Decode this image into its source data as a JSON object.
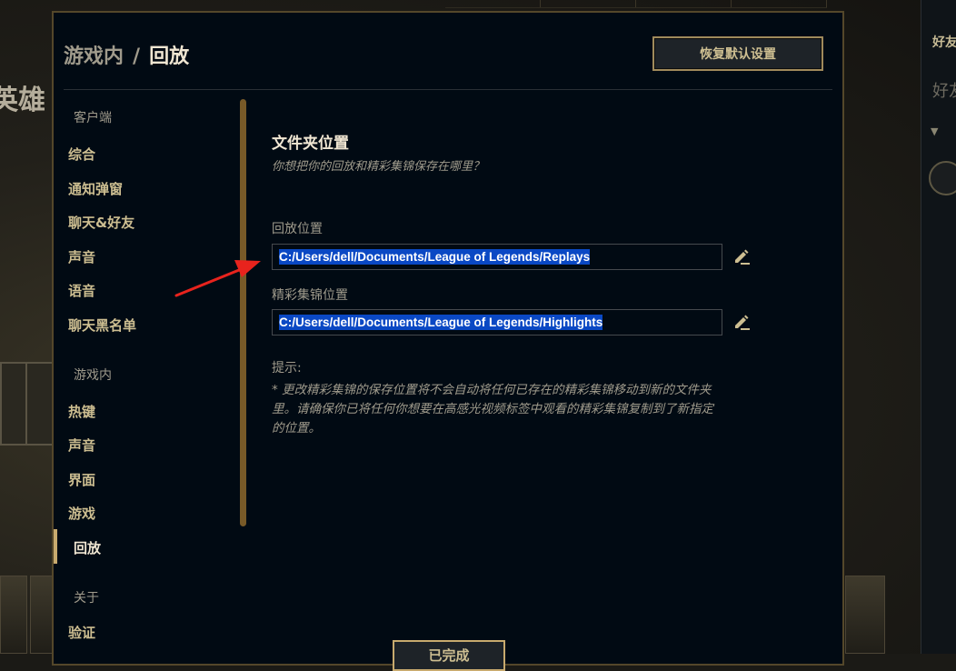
{
  "breadcrumb": {
    "parent": "游戏内",
    "separator": "/",
    "current": "回放"
  },
  "reset_button": "恢复默认设置",
  "sidebar": {
    "client_section": "客户端",
    "client_items": [
      "综合",
      "通知弹窗",
      "聊天&好友",
      "声音",
      "语音",
      "聊天黑名单"
    ],
    "ingame_section": "游戏内",
    "ingame_items": [
      "热键",
      "声音",
      "界面",
      "游戏",
      "回放"
    ],
    "about_section": "关于",
    "about_items": [
      "验证"
    ]
  },
  "content": {
    "title": "文件夹位置",
    "subtitle": "你想把你的回放和精彩集锦保存在哪里？",
    "replay_label": "回放位置",
    "replay_path": "C:/Users/dell/Documents/League of Legends/Replays",
    "highlight_label": "精彩集锦位置",
    "highlight_path": "C:/Users/dell/Documents/League of Legends/Highlights",
    "hint_label": "提示:",
    "hint_text": "* 更改精彩集锦的保存位置将不会自动将任何已存在的精彩集锦移动到新的文件夹里。请确保你已将任何你想要在高感光视频标签中观看的精彩集锦复制到了新指定的位置。"
  },
  "done_button": "已完成",
  "background": {
    "hero_title": "英雄",
    "friends_title": "好友",
    "friends_search": "好友"
  },
  "colors": {
    "gold": "#c8aa6e",
    "gold_text": "#cdbe91",
    "selection": "#0a48c4",
    "modal_bg": "#010a13",
    "annotation_arrow": "#e8231d"
  },
  "icons": {
    "edit": "pencil-edit-icon",
    "collapse": "caret-down-icon"
  }
}
